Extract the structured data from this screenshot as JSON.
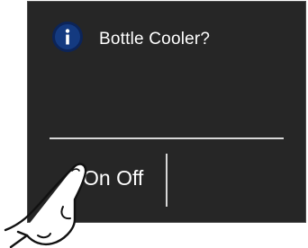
{
  "dialog": {
    "title": "Bottle Cooler?",
    "icon": "info-icon",
    "toggle_label": "On Off"
  },
  "colors": {
    "panel_background": "#262626",
    "text": "#ffffff",
    "icon_fill": "#143a80",
    "divider": "#d7d7d7"
  }
}
